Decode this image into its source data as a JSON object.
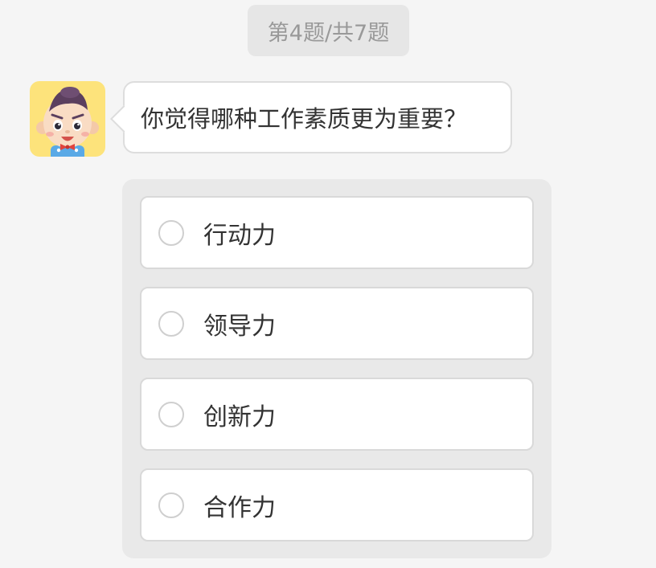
{
  "progress": {
    "text": "第4题/共7题",
    "current": 4,
    "total": 7
  },
  "avatar": {
    "icon": "cartoon-boy-avatar",
    "background": "#fde37b"
  },
  "question": {
    "text": "你觉得哪种工作素质更为重要？"
  },
  "options": [
    {
      "label": "行动力",
      "selected": false
    },
    {
      "label": "领导力",
      "selected": false
    },
    {
      "label": "创新力",
      "selected": false
    },
    {
      "label": "合作力",
      "selected": false
    }
  ]
}
